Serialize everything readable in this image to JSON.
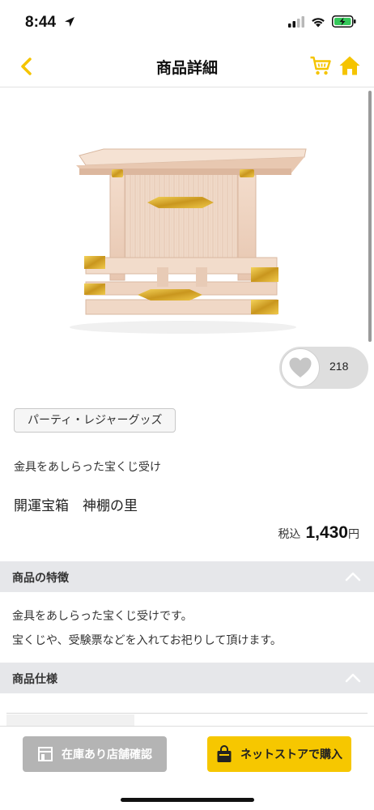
{
  "status_bar": {
    "time": "8:44"
  },
  "nav": {
    "title": "商品詳細"
  },
  "product": {
    "favorite_count": "218",
    "category": "パーティ・レジャーグッズ",
    "catch_copy": "金具をあしらった宝くじ受け",
    "name": "開運宝箱　神棚の里",
    "price_tax_label": "税込",
    "price": "1,430",
    "price_unit": "円"
  },
  "sections": {
    "features": {
      "title": "商品の特徴",
      "lines": [
        "金具をあしらった宝くじ受けです。",
        "宝くじや、受験票などを入れてお祀りして頂けます。"
      ]
    },
    "specs": {
      "title": "商品仕様"
    }
  },
  "actions": {
    "stock_label": "在庫あり店舗確認",
    "buy_label": "ネットストアで購入"
  },
  "colors": {
    "accent": "#f6c700",
    "nav_icon": "#f5c400",
    "section_bg": "#e6e7ea",
    "disabled_button": "#b4b4b4"
  },
  "icons": [
    "location-arrow-icon",
    "signal-icon",
    "wifi-icon",
    "battery-icon",
    "back-chevron-icon",
    "cart-icon",
    "home-icon",
    "heart-icon",
    "chevron-up-icon",
    "store-icon",
    "shopping-bag-icon"
  ]
}
